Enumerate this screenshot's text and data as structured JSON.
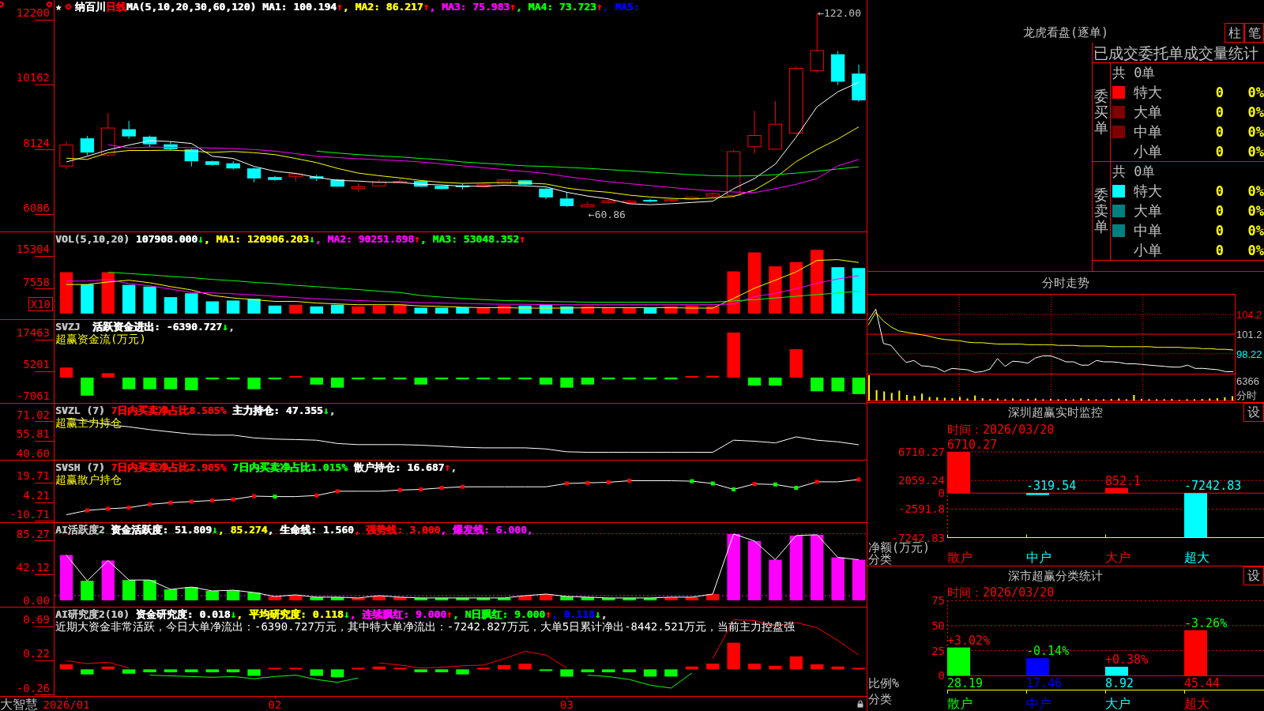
{
  "main_chart": {
    "stock": {
      "symbol": "★",
      "name": "纳百川",
      "period": "日线"
    },
    "panes": [
      {
        "legend": [
          {
            "text": "MA(5,10,20,30,60,120) MA1: 100.194",
            "color": "#ffffff"
          },
          {
            "text": "↑",
            "color": "#ff0000"
          },
          {
            "text": ", MA2: 86.217",
            "color": "#ffff00"
          },
          {
            "text": "↑",
            "color": "#ff0000"
          },
          {
            "text": ", MA3: 75.983",
            "color": "#ff00ff"
          },
          {
            "text": "↑",
            "color": "#ff0000"
          },
          {
            "text": ", MA4: 73.723",
            "color": "#00ff00"
          },
          {
            "text": "↑",
            "color": "#ff0000"
          },
          {
            "text": ", MA5:",
            "color": "#0000ff"
          }
        ]
      },
      {
        "legend": [
          {
            "text": "VOL(5,10,20)"
          },
          {
            "text": " 107908.000",
            "color": "#ffffff"
          },
          {
            "text": "↓",
            "color": "#00ff00"
          },
          {
            "text": ", MA1: 120906.203",
            "color": "#ffff00"
          },
          {
            "text": "↓",
            "color": "#00ff00"
          },
          {
            "text": ", MA2: 90251.898",
            "color": "#ff00ff"
          },
          {
            "text": "↑",
            "color": "#ff0000"
          },
          {
            "text": ", MA3: 53048.352",
            "color": "#00ff00"
          },
          {
            "text": "↑",
            "color": "#ff0000"
          }
        ],
        "unit": "X10"
      },
      {
        "legend": [
          {
            "text": "SVZJ"
          },
          {
            "text": "  活跃资金进出: -6390.727",
            "color": "#ffffff"
          },
          {
            "text": "↓",
            "color": "#00ff00"
          },
          {
            "text": ","
          }
        ],
        "caption": {
          "text": "超赢资金流(万元)",
          "color": "#ffff00"
        }
      },
      {
        "legend": [
          {
            "text": "SVZL (7)"
          },
          {
            "text": " 7日内买卖净占比8.585%",
            "color": "#ff0000"
          },
          {
            "text": " 主力持仓: 47.355",
            "color": "#ffffff"
          },
          {
            "text": "↓",
            "color": "#00ff00"
          },
          {
            "text": ","
          }
        ],
        "caption": {
          "text": "超赢主力持仓",
          "color": "#ffff00"
        }
      },
      {
        "legend": [
          {
            "text": "SVSH (7)"
          },
          {
            "text": " 7日内买卖净占比2.985%",
            "color": "#ff0000"
          },
          {
            "text": " 7日内买卖净占比1.015%",
            "color": "#00ff00"
          },
          {
            "text": " 散户持仓: 16.687",
            "color": "#ffffff"
          },
          {
            "text": "↑",
            "color": "#ff0000"
          },
          {
            "text": ","
          }
        ],
        "caption": {
          "text": "超赢散户持仓",
          "color": "#ffff00"
        }
      },
      {
        "legend": [
          {
            "text": "AI活跃度2"
          },
          {
            "text": " 资金活跃度: 51.809",
            "color": "#ffffff"
          },
          {
            "text": "↓",
            "color": "#00ff00"
          },
          {
            "text": ", 85.274",
            "color": "#ffff00"
          },
          {
            "text": ", 生命线: 1.560",
            "color": "#ffffff"
          },
          {
            "text": ", 强势线: 3.000",
            "color": "#ff0000"
          },
          {
            "text": ", 爆发线: 6.000,",
            "color": "#ff00ff"
          }
        ]
      },
      {
        "legend": [
          {
            "text": "AI研究度2(10)"
          },
          {
            "text": " 资金研究度: 0.018",
            "color": "#ffffff"
          },
          {
            "text": "↓",
            "color": "#00ff00"
          },
          {
            "text": ", 平均研究度: 0.118",
            "color": "#ffff00"
          },
          {
            "text": "↓",
            "color": "#00ff00"
          },
          {
            "text": ", 连续飘红: 9.000",
            "color": "#ff00ff"
          },
          {
            "text": "↑",
            "color": "#ff0000"
          },
          {
            "text": ", N日飘红: 9.000",
            "color": "#00ff00"
          },
          {
            "text": "↑",
            "color": "#ff0000"
          },
          {
            "text": ", 0.118",
            "color": "#0000ff"
          },
          {
            "text": "↓",
            "color": "#00ff00"
          },
          {
            "text": ","
          }
        ],
        "caption": {
          "text": "近期大资金非常活跃，今日大单净流出：-6390.727万元，其中特大单净流出：-7242.827万元，大单5日累计净出-8442.521万元，当前主力控盘强",
          "color": "#ffffff"
        }
      }
    ],
    "chart_data": [
      {
        "type": "candlestick",
        "ylim": [
          5340,
          12600
        ],
        "yticks": [
          6086,
          8124,
          10162,
          12200
        ],
        "ohlc": [
          [
            7379,
            8162,
            7292,
            8063
          ],
          [
            8261,
            8336,
            7727,
            7814
          ],
          [
            7727,
            9056,
            7690,
            8597
          ],
          [
            8547,
            8808,
            8249,
            8323
          ],
          [
            8311,
            8348,
            7975,
            8075
          ],
          [
            8075,
            8162,
            7876,
            7926
          ],
          [
            7913,
            7938,
            7379,
            7541
          ],
          [
            7541,
            7565,
            7404,
            7429
          ],
          [
            7478,
            7541,
            7280,
            7317
          ],
          [
            7317,
            7342,
            6882,
            7006
          ],
          [
            7044,
            7081,
            6932,
            6957
          ],
          [
            7056,
            7192,
            6907,
            7155
          ],
          [
            7068,
            7118,
            6920,
            6994
          ],
          [
            6969,
            6994,
            6733,
            6745
          ],
          [
            6671,
            6845,
            6597,
            6758
          ],
          [
            6758,
            6969,
            6758,
            6907
          ],
          [
            6857,
            6994,
            6845,
            6920
          ],
          [
            6920,
            6944,
            6733,
            6745
          ],
          [
            6770,
            6795,
            6659,
            6671
          ],
          [
            6783,
            6845,
            6659,
            6733
          ],
          [
            6733,
            6882,
            6708,
            6820
          ],
          [
            6832,
            6982,
            6808,
            6969
          ],
          [
            6944,
            6957,
            6783,
            6808
          ],
          [
            6684,
            6708,
            6348,
            6410
          ],
          [
            6373,
            6584,
            6112,
            6137
          ],
          [
            6100,
            6261,
            6086,
            6186
          ],
          [
            6236,
            6335,
            6211,
            6310
          ],
          [
            6230,
            6330,
            6200,
            6300
          ],
          [
            6330,
            6360,
            6250,
            6280
          ],
          [
            6290,
            6380,
            6270,
            6350
          ],
          [
            6340,
            6450,
            6320,
            6420
          ],
          [
            6440,
            6560,
            6420,
            6530
          ],
          [
            6461,
            7907,
            6385,
            7856
          ],
          [
            7983,
            9124,
            7780,
            8363
          ],
          [
            7907,
            9428,
            7907,
            8718
          ],
          [
            8414,
            10518,
            8388,
            10468
          ],
          [
            10366,
            12200,
            10315,
            11025
          ],
          [
            10899,
            11000,
            9935,
            10037
          ],
          [
            10290,
            10569,
            9402,
            9453
          ]
        ],
        "series": [
          {
            "type": "line",
            "color": "#ffffff",
            "values": [
              7520,
              7700,
              7900,
              8050,
              8190,
              8160,
              8100,
              7700,
              7630,
              7380,
              7230,
              7160,
              7040,
              6940,
              6920,
              6880,
              6880,
              6820,
              6800,
              6760,
              6760,
              6790,
              6770,
              6740,
              6570,
              6450,
              6360,
              6210,
              6180,
              6210,
              6250,
              6290,
              6680,
              7000,
              7450,
              8300,
              9250,
              9720,
              10020
            ]
          },
          {
            "type": "line",
            "color": "#ffff00",
            "values": [
              7640,
              7600,
              7810,
              7880,
              7880,
              7890,
              7860,
              7820,
              7850,
              7810,
              7750,
              7630,
              7500,
              7320,
              7170,
              7090,
              7020,
              6940,
              6880,
              6850,
              6860,
              6880,
              6860,
              6830,
              6700,
              6620,
              6570,
              6480,
              6420,
              6380,
              6360,
              6390,
              6440,
              6640,
              7020,
              7530,
              7910,
              8240,
              8620
            ]
          },
          {
            "type": "line",
            "color": "#ff00ff",
            "values": [
              null,
              null,
              8060,
              7960,
              7990,
              7980,
              7970,
              7960,
              7940,
              7910,
              7860,
              7780,
              7700,
              7660,
              7620,
              7590,
              7560,
              7520,
              7460,
              7400,
              7340,
              7280,
              7220,
              7160,
              7060,
              6980,
              6900,
              6840,
              6780,
              6720,
              6660,
              6610,
              6580,
              6560,
              6680,
              6820,
              7000,
              7400,
              7600
            ]
          },
          {
            "type": "line",
            "color": "#00ff00",
            "values": [
              null,
              null,
              null,
              null,
              null,
              null,
              null,
              null,
              null,
              null,
              null,
              null,
              7860,
              7800,
              7750,
              7710,
              7680,
              7630,
              7590,
              7520,
              7480,
              7440,
              7400,
              7380,
              7350,
              7320,
              7280,
              7240,
              7200,
              7160,
              7120,
              7090,
              7080,
              7090,
              7120,
              7170,
              7230,
              7300,
              7370
            ]
          }
        ],
        "annotations": [
          "←122.00",
          "←60.86"
        ]
      },
      {
        "type": "bar",
        "ylim": [
          -1320,
          19270
        ],
        "yticks": [
          7558,
          15304
        ],
        "series": [
          {
            "type": "bar",
            "values": [
              9800,
              6900,
              9800,
              6800,
              6400,
              3900,
              4800,
              2900,
              3100,
              3500,
              1900,
              2100,
              1700,
              2100,
              1700,
              1900,
              2100,
              1400,
              1400,
              1500,
              1500,
              1900,
              1900,
              2100,
              1700,
              1700,
              1500,
              1500,
              1400,
              1700,
              1900,
              1700,
              10000,
              14500,
              11200,
              12200,
              15100,
              11000,
              10800
            ],
            "colors": [
              "#ff0000",
              "#00ffff",
              "#ff0000",
              "#00ffff",
              "#00ffff",
              "#00ffff",
              "#00ffff",
              "#00ffff",
              "#00ffff",
              "#00ffff",
              "#00ffff",
              "#ff0000",
              "#00ffff",
              "#00ffff",
              "#ff0000",
              "#ff0000",
              "#ff0000",
              "#00ffff",
              "#00ffff",
              "#00ffff",
              "#ff0000",
              "#ff0000",
              "#00ffff",
              "#00ffff",
              "#00ffff",
              "#ff0000",
              "#ff0000",
              "#ff0000",
              "#00ffff",
              "#ff0000",
              "#ff0000",
              "#ff0000",
              "#ff0000",
              "#ff0000",
              "#ff0000",
              "#ff0000",
              "#ff0000",
              "#00ffff",
              "#00ffff"
            ]
          },
          {
            "type": "line",
            "color": "#ffff00",
            "values": [
              6900,
              6900,
              7500,
              7900,
              7300,
              6400,
              5600,
              4300,
              3700,
              3300,
              2900,
              2900,
              2500,
              2300,
              2100,
              2100,
              2100,
              1800,
              1700,
              1500,
              1400,
              1400,
              1300,
              1300,
              1300,
              1400,
              1400,
              1400,
              1400,
              1400,
              1300,
              1300,
              3600,
              6000,
              7900,
              9900,
              12600,
              12800,
              12100
            ]
          },
          {
            "type": "line",
            "color": "#ff00ff",
            "values": [
              7700,
              7700,
              8100,
              7100,
              6600,
              5800,
              5000,
              4900,
              4700,
              4400,
              4100,
              3800,
              3500,
              3300,
              3100,
              2900,
              2800,
              2600,
              2500,
              2400,
              2300,
              2200,
              2200,
              2100,
              2100,
              2100,
              2100,
              2100,
              2100,
              2100,
              2100,
              2100,
              2300,
              4000,
              4800,
              5900,
              7200,
              8200,
              9000
            ]
          },
          {
            "type": "line",
            "color": "#00ff00",
            "values": [
              null,
              null,
              9800,
              9500,
              9200,
              8800,
              8500,
              8100,
              7800,
              7400,
              7100,
              6700,
              6400,
              6000,
              5700,
              5300,
              5000,
              4300,
              3900,
              3600,
              3300,
              3100,
              3000,
              2900,
              2800,
              2700,
              2700,
              2700,
              2700,
              2700,
              2700,
              2700,
              3000,
              3300,
              3700,
              4100,
              4500,
              4900,
              5300
            ]
          }
        ]
      },
      {
        "type": "bar",
        "ylim": [
          -9820,
          22370
        ],
        "yticks": [
          -7061,
          5201,
          17463
        ],
        "values": [
          3900,
          -7000,
          1700,
          -4500,
          -4500,
          -4500,
          -4900,
          -700,
          -700,
          -4500,
          -700,
          300,
          -2700,
          -3900,
          -700,
          -700,
          -700,
          -2700,
          -700,
          -700,
          -700,
          -700,
          -700,
          -2700,
          -3900,
          -2700,
          -700,
          -700,
          -700,
          -700,
          300,
          700,
          17500,
          -3100,
          -3100,
          11000,
          -5300,
          -5300,
          -6400
        ],
        "colors": [
          "#ff0000",
          "#00ff00",
          "#ff0000",
          "#00ff00",
          "#00ff00",
          "#00ff00",
          "#00ff00",
          "#00ff00",
          "#00ff00",
          "#00ff00",
          "#00ff00",
          "#ff0000",
          "#00ff00",
          "#00ff00",
          "#00ff00",
          "#00ff00",
          "#00ff00",
          "#00ff00",
          "#00ff00",
          "#00ff00",
          "#00ff00",
          "#00ff00",
          "#00ff00",
          "#00ff00",
          "#00ff00",
          "#00ff00",
          "#00ff00",
          "#00ff00",
          "#00ff00",
          "#00ff00",
          "#ff0000",
          "#ff0000",
          "#ff0000",
          "#00ff00",
          "#00ff00",
          "#ff0000",
          "#00ff00",
          "#00ff00",
          "#00ff00"
        ]
      },
      {
        "type": "line",
        "ylim": [
          35.6,
          79.7
        ],
        "yticks": [
          {
            "value": 40.6,
            "label": "40.60"
          },
          55.81,
          71.02
        ],
        "color": "#ffffff",
        "values": [
          68.0,
          65.8,
          63.2,
          61.5,
          59.3,
          57.5,
          55.8,
          55.0,
          55.0,
          52.8,
          51.9,
          51.5,
          51.0,
          48.4,
          47.5,
          47.5,
          47.5,
          47.1,
          46.3,
          45.4,
          45.0,
          45.0,
          45.0,
          44.1,
          41.9,
          41.5,
          41.5,
          41.5,
          41.5,
          41.5,
          41.5,
          41.5,
          51.0,
          50.2,
          48.9,
          53.6,
          51.0,
          49.7,
          47.4
        ]
      },
      {
        "type": "line",
        "ylim": [
          -17,
          31.7
        ],
        "yticks": [
          -10.71,
          4.21,
          19.71
        ],
        "color": "#ffffff",
        "marker": "square",
        "values": [
          -11.1,
          -7.7,
          -6.4,
          -5.5,
          -2.9,
          -1.6,
          -0.7,
          0.2,
          1.0,
          3.6,
          3.2,
          3.2,
          4.1,
          7.5,
          7.5,
          7.5,
          8.4,
          8.9,
          10.1,
          11.0,
          11.0,
          11.0,
          11.0,
          11.0,
          13.6,
          14.1,
          14.5,
          15.8,
          15.8,
          15.8,
          15.4,
          13.6,
          8.9,
          13.2,
          12.8,
          10.1,
          14.9,
          14.9,
          16.7
        ]
      },
      {
        "type": "bar",
        "ylim": [
          -8.2,
          99.1
        ],
        "yticks": [
          {
            "value": 0,
            "label": "0.00"
          },
          42.12,
          85.27
        ],
        "ref_lines": [
          {
            "axis": "y",
            "value": 85.274,
            "color": "#ff0000",
            "line_style": "dotted"
          },
          {
            "axis": "y",
            "value": 6,
            "color": "#ff00ff",
            "line_style": "dotted"
          }
        ],
        "series": [
          {
            "type": "bar",
            "values": [
              58,
              25,
              51,
              26,
              26,
              14,
              17,
              12,
              13,
              10,
              5,
              7,
              4,
              4,
              3,
              6,
              4,
              3,
              3,
              3,
              3,
              3,
              6,
              8,
              5,
              4,
              3,
              3,
              3,
              4,
              4,
              8,
              85,
              76,
              52,
              83,
              84,
              55,
              52
            ],
            "colors": [
              "#ff00ff",
              "#00ff00",
              "#ff00ff",
              "#00ff00",
              "#00ff00",
              "#00ff00",
              "#00ff00",
              "#00ff00",
              "#00ff00",
              "#00ff00",
              "#ff0000",
              "#ff0000",
              "#00ff00",
              "#00ff00",
              "#ff0000",
              "#ff0000",
              "#ff0000",
              "#00ff00",
              "#00ff00",
              "#00ff00",
              "#00ff00",
              "#00ff00",
              "#ff0000",
              "#ff0000",
              "#00ff00",
              "#00ff00",
              "#00ff00",
              "#00ff00",
              "#00ff00",
              "#ff0000",
              "#ff0000",
              "#ff0000",
              "#ff00ff",
              "#ff00ff",
              "#ff00ff",
              "#ff00ff",
              "#ff00ff",
              "#ff00ff",
              "#ff00ff"
            ]
          },
          {
            "type": "line",
            "color": "#ffffff",
            "values": [
              58,
              25,
              51,
              26,
              26,
              14,
              17,
              12,
              13,
              10,
              5,
              7,
              4,
              4,
              3,
              6,
              4,
              3,
              3,
              3,
              3,
              3,
              6,
              8,
              5,
              4,
              3,
              3,
              3,
              4,
              4,
              8,
              85,
              76,
              52,
              83,
              84,
              55,
              52
            ]
          }
        ]
      },
      {
        "type": "bar",
        "categories": [
          "2026/01",
          null,
          null,
          null,
          null,
          null,
          null,
          null,
          null,
          null,
          "02",
          null,
          null,
          null,
          null,
          null,
          null,
          null,
          null,
          null,
          null,
          null,
          null,
          null,
          "03",
          null,
          null,
          null,
          null,
          null,
          null,
          null,
          null,
          null,
          null,
          null,
          null,
          null,
          null
        ],
        "ylim": [
          -0.37,
          0.86
        ],
        "yticks": [
          -0.26,
          0.22,
          0.69
        ],
        "series": [
          {
            "type": "bar",
            "values": [
              0.07,
              -0.07,
              0.04,
              -0.06,
              -0.04,
              -0.04,
              -0.04,
              -0.04,
              -0.04,
              -0.09,
              0.01,
              0.02,
              -0.09,
              -0.11,
              0.01,
              0.04,
              0.01,
              -0.04,
              -0.04,
              -0.07,
              0.01,
              0.06,
              0.08,
              -0.02,
              -0.1,
              -0.04,
              -0.04,
              -0.04,
              -0.1,
              -0.1,
              0.04,
              0.08,
              0.37,
              0.08,
              0.05,
              0.18,
              0.07,
              0.04,
              0.02
            ],
            "colors": [
              "#ff0000",
              "#00ff00",
              "#ff0000",
              "#00ff00",
              "#00ff00",
              "#00ff00",
              "#00ff00",
              "#00ff00",
              "#00ff00",
              "#00ff00",
              "#ff0000",
              "#ff0000",
              "#00ff00",
              "#00ff00",
              "#ff0000",
              "#ff0000",
              "#ff0000",
              "#00ff00",
              "#00ff00",
              "#00ff00",
              "#ff0000",
              "#ff0000",
              "#ff0000",
              "#00ff00",
              "#00ff00",
              "#00ff00",
              "#00ff00",
              "#00ff00",
              "#00ff00",
              "#00ff00",
              "#ff0000",
              "#ff0000",
              "#ff0000",
              "#ff0000",
              "#ff0000",
              "#ff0000",
              "#ff0000",
              "#ff0000",
              "#ff0000"
            ]
          },
          {
            "type": "line",
            "color": "#ff0000",
            "values": [
              0.12,
              0.08,
              0.1,
              0.02,
              null,
              null,
              null,
              null,
              null,
              null,
              null,
              null,
              null,
              null,
              null,
              0.09,
              0.06,
              0.02,
              0.03,
              0.05,
              0.06,
              0.15,
              0.25,
              0.2,
              0.02,
              null,
              null,
              null,
              null,
              null,
              null,
              0.15,
              0.69,
              0.68,
              0.6,
              0.65,
              0.58,
              0.4,
              0.2
            ]
          },
          {
            "type": "line",
            "color": "#00ff00",
            "values": [
              null,
              null,
              null,
              null,
              -0.08,
              -0.09,
              -0.1,
              -0.11,
              -0.1,
              -0.13,
              -0.1,
              -0.08,
              -0.14,
              -0.18,
              -0.12,
              null,
              null,
              null,
              null,
              null,
              null,
              null,
              null,
              null,
              null,
              -0.08,
              -0.1,
              -0.14,
              -0.22,
              -0.26,
              -0.05,
              null,
              null,
              null,
              null,
              null,
              null,
              null,
              null
            ]
          }
        ]
      }
    ],
    "brand": "大智慧"
  },
  "dragon_tiger": {
    "title": "龙虎看盘(逐单)",
    "buttons": [
      "柱",
      "笔"
    ],
    "stats": {
      "title": "已成交委托单成交量统计",
      "groups": [
        {
          "label": "委买单",
          "total": "共 0单",
          "rows": [
            {
              "label": "特大",
              "count": "0",
              "percent": "0%",
              "color": "#ff0000"
            },
            {
              "label": "大单",
              "count": "0",
              "percent": "0%",
              "color": "#800000"
            },
            {
              "label": "中单",
              "count": "0",
              "percent": "0%",
              "color": "#800000"
            },
            {
              "label": "小单",
              "count": "0",
              "percent": "0%"
            }
          ]
        },
        {
          "label": "委卖单",
          "total": "共 0单",
          "rows": [
            {
              "label": "特大",
              "count": "0",
              "percent": "0%",
              "color": "#00ffff"
            },
            {
              "label": "大单",
              "count": "0",
              "percent": "0%",
              "color": "#008080"
            },
            {
              "label": "中单",
              "count": "0",
              "percent": "0%",
              "color": "#008080"
            },
            {
              "label": "小单",
              "count": "0",
              "percent": "0%"
            }
          ]
        }
      ]
    }
  },
  "intraday": {
    "title": "分时走势",
    "volume_label": "6366",
    "pane_label": "分时",
    "chart_data": [
      {
        "type": "line",
        "categories": [
          null,
          null,
          null,
          null,
          null,
          null,
          null,
          null,
          null,
          null,
          null,
          null,
          null,
          null,
          null,
          null,
          null,
          null,
          null,
          null,
          null,
          null,
          null,
          null,
          null,
          null,
          null,
          null,
          null,
          null,
          null,
          null,
          null,
          null,
          null,
          null,
          null,
          null,
          null,
          null,
          null,
          null,
          null,
          null,
          null,
          null,
          null,
          null,
          null
        ],
        "ylim": [
          95.2,
          107.2
        ],
        "yticks": [
          98.22,
          101.2,
          104.2
        ],
        "grid": true,
        "ref_lines": [
          {
            "axis": "y",
            "value": 101.2,
            "color": "#ff0000"
          }
        ],
        "series": [
          {
            "color": "#ffffff",
            "values": [
              103.3,
              105.0,
              99.8,
              99.5,
              98.1,
              96.9,
              97.2,
              96.4,
              96.3,
              96.1,
              95.5,
              96.0,
              95.9,
              95.8,
              95.4,
              95.5,
              95.9,
              97.5,
              96.3,
              97.1,
              97.0,
              96.8,
              97.6,
              97.9,
              97.9,
              97.5,
              97.0,
              97.0,
              96.5,
              96.5,
              97.2,
              97.0,
              97.0,
              96.9,
              96.7,
              96.7,
              96.6,
              96.5,
              96.4,
              96.3,
              96.2,
              96.2,
              96.5,
              96.0,
              96.0,
              95.9,
              95.8,
              95.5,
              95.5
            ]
          },
          {
            "color": "#ffff00",
            "values": [
              102.6,
              104.5,
              103.2,
              102.3,
              101.7,
              101.5,
              101.3,
              101.1,
              100.9,
              100.6,
              100.4,
              100.3,
              100.2,
              100.0,
              99.9,
              99.9,
              99.8,
              99.7,
              99.7,
              99.7,
              99.7,
              99.6,
              99.6,
              99.6,
              99.6,
              99.5,
              99.5,
              99.5,
              99.4,
              99.4,
              99.4,
              99.4,
              99.3,
              99.3,
              99.3,
              99.3,
              99.3,
              99.3,
              99.2,
              99.2,
              99.2,
              99.2,
              99.1,
              99.1,
              99.0,
              99.0,
              98.9,
              98.9,
              98.8
            ]
          }
        ]
      }
    ]
  },
  "sz_monitor": {
    "title": "深圳超赢实时监控",
    "button": "设",
    "time": "时间：2026/03/20",
    "chart_data": {
      "type": "bar",
      "categories": [
        "散户",
        "中户",
        "大户",
        "超大"
      ],
      "values": [
        6710.27,
        -319.54,
        852.1,
        -7242.83
      ],
      "colors": [
        "#ff0000",
        "#00ffff",
        "#ff0000",
        "#00ffff"
      ],
      "ylim": [
        -7242.83,
        6710.27
      ],
      "yticks": [
        -7242.83,
        -2591.8,
        0,
        2059.24,
        6710.27
      ],
      "grid": true,
      "ref_lines": [
        {
          "axis": "y",
          "value": 0,
          "color": "#ff0000"
        }
      ],
      "data_labels": true,
      "xlabel": "分类",
      "ylabel": "净额(万元)"
    }
  },
  "sz_stats": {
    "title": "深市超赢分类统计",
    "button": "设",
    "time": "时间：2026/03/20",
    "changes": [
      {
        "text": "+3.02%",
        "color": "#ff0000"
      },
      {
        "text": "-0.14%",
        "color": "#00ff00"
      },
      {
        "text": "+0.38%",
        "color": "#ff0000"
      },
      {
        "text": "-3.26%",
        "color": "#00ff00"
      }
    ],
    "chart_data": {
      "type": "bar",
      "categories": [
        "散户",
        "中户",
        "大户",
        "超大"
      ],
      "values": [
        28.19,
        17.46,
        8.92,
        45.44
      ],
      "colors": [
        "#00ff00",
        "#0000ff",
        "#00ffff",
        "#ff0000"
      ],
      "ylim": [
        0,
        75
      ],
      "yticks": [
        0,
        25,
        50,
        75
      ],
      "grid": true,
      "data_labels": true,
      "xlabel": "分类",
      "ylabel": "比例%"
    }
  }
}
